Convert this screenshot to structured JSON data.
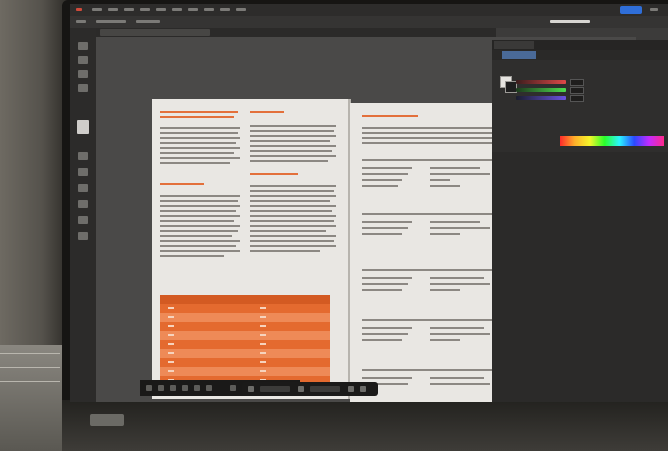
{
  "app": {
    "accent_color": "#e3703b",
    "share_color": "#2f6ed8",
    "active_tool_icon": "select-icon"
  },
  "panel": {
    "tabs": [],
    "color_model": "RGB"
  },
  "document": {
    "orange_heading_color": "#e3703b",
    "table_row_count": 11
  }
}
